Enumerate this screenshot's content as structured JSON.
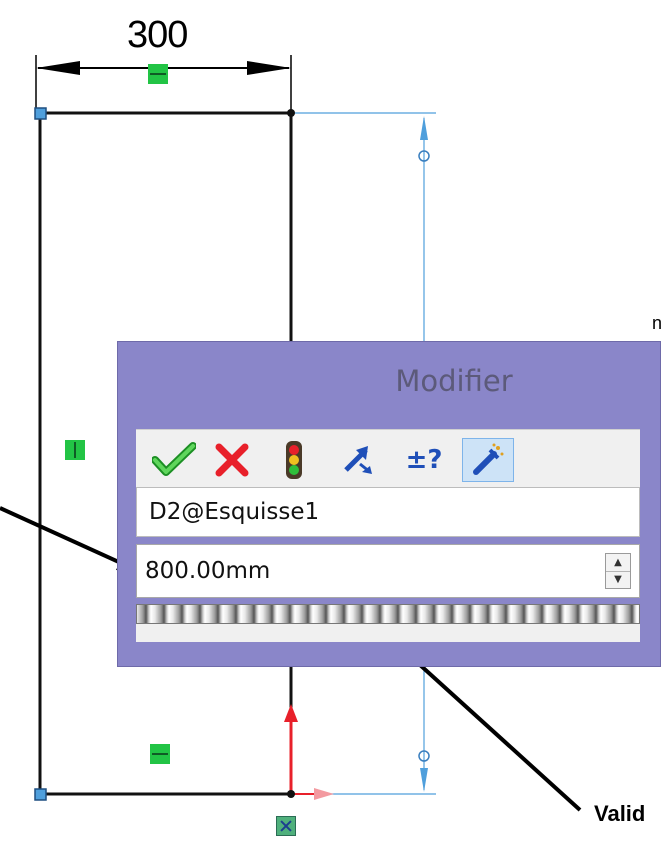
{
  "sketch": {
    "dimension_horizontal": "300",
    "partial_label_right": "n",
    "annotation_label": "Valid"
  },
  "dialog": {
    "title": "Modifier",
    "toolbar": {
      "ok_icon": "check-icon",
      "cancel_icon": "x-icon",
      "rebuild_icon": "traffic-light-icon",
      "reverse_icon": "reverse-direction-icon",
      "tolerance_label": "±?",
      "mark_dimension_icon": "mark-dimension-icon"
    },
    "dimension_name": "D2@Esquisse1",
    "value": "800.00mm"
  },
  "colors": {
    "dialog_bg": "#8a86c9",
    "relation_green": "#22c445",
    "geometry_black": "#111111",
    "construction_blue": "#4f9fdc",
    "ok_green": "#1faa2a",
    "cancel_red": "#e8202a"
  }
}
